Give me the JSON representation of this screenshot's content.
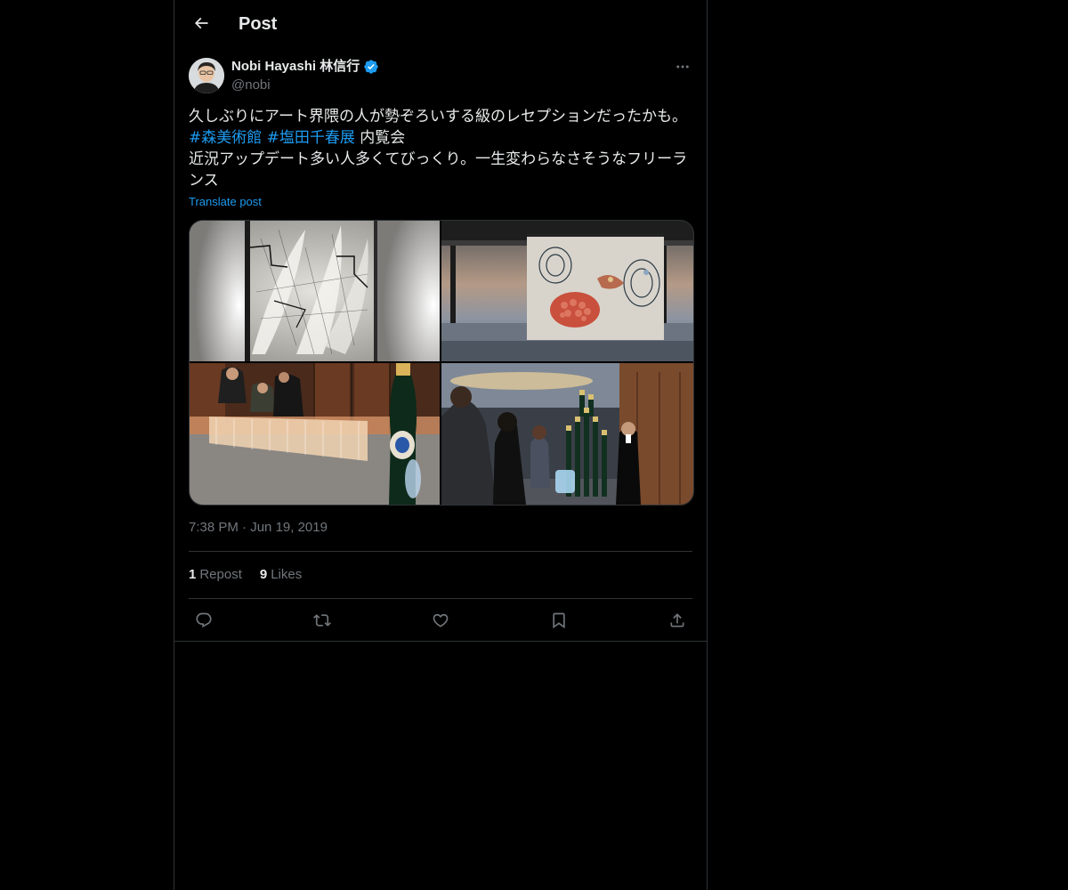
{
  "header": {
    "title": "Post",
    "back_icon": "arrow-left-icon"
  },
  "author": {
    "name": "Nobi Hayashi 林信行",
    "handle": "@nobi",
    "verified": true,
    "verified_color": "#1d9bf0"
  },
  "post": {
    "line1": "久しぶりにアート界隈の人が勢ぞろいする級のレセプションだったかも。",
    "hashtag1": "#森美術館",
    "hashtag2": "#塩田千春展",
    "after_hashtags": " 内覧会",
    "line3": "近況アップデート多い人多くてびっくり。一生変わらなさそうなフリーランス",
    "translate_label": "Translate post"
  },
  "timestamp": {
    "time": "7:38 PM",
    "separator": "·",
    "date": "Jun 19, 2019"
  },
  "stats": {
    "reposts_count": "1",
    "reposts_label": "Repost",
    "likes_count": "9",
    "likes_label": "Likes"
  },
  "actions": [
    "reply-icon",
    "repost-icon",
    "like-icon",
    "bookmark-icon",
    "share-icon"
  ],
  "colors": {
    "background": "#000000",
    "text": "#e7e9ea",
    "muted": "#71767b",
    "accent": "#1d9bf0",
    "border": "#2f3336"
  }
}
